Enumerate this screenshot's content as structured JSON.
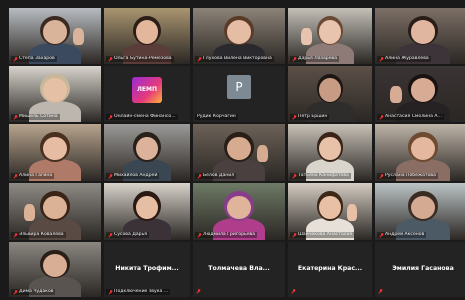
{
  "participants": [
    {
      "name": "Стёпа Захаров",
      "muted": true,
      "kind": "video",
      "bg": "#b8bcc0",
      "skin": "#d9b39a",
      "hair": "#3a2a20",
      "shirt": "#3b4a5e"
    },
    {
      "name": "Ольга Бутина-Ремезова",
      "muted": true,
      "kind": "video",
      "active": true,
      "bg": "#a99570",
      "skin": "#e2b79c",
      "hair": "#2c1d16",
      "shirt": "#5a3c38"
    },
    {
      "name": "Глухова Вилена Викторовна",
      "muted": true,
      "kind": "video",
      "bg": "#8c8378",
      "skin": "#e4bda4",
      "hair": "#5a3b28",
      "shirt": "#2a2a2e"
    },
    {
      "name": "Дарья Лазарева",
      "muted": true,
      "kind": "video",
      "bg": "#c4c0b8",
      "skin": "#e8c4ae",
      "hair": "#6a4a34",
      "shirt": "#8e7b78"
    },
    {
      "name": "Алина Журавлёва",
      "muted": true,
      "kind": "video",
      "bg": "#7c6f66",
      "skin": "#e0b6a0",
      "hair": "#2a1c16",
      "shirt": "#3c3438"
    },
    {
      "name": "Мишель Сотина",
      "muted": true,
      "kind": "video",
      "bg": "#d8d4cc",
      "skin": "#e6c0a4",
      "hair": "#c9b79a",
      "shirt": "#bcb6ae"
    },
    {
      "name": "Онлайн-смена Финансо...",
      "muted": true,
      "kind": "logo",
      "logo_text": "ЛЕМП"
    },
    {
      "name": "Рудик Корчагин",
      "muted": false,
      "kind": "avatar",
      "initial": "P"
    },
    {
      "name": "Пётр Ершин",
      "muted": true,
      "kind": "video",
      "bg": "#5c5048",
      "skin": "#c89c84",
      "hair": "#1e1612",
      "shirt": "#2f2c2c"
    },
    {
      "name": "Анастасия Смолина А...",
      "muted": true,
      "kind": "video",
      "bg": "#3a3434",
      "skin": "#d8ac94",
      "hair": "#1a1210",
      "shirt": "#262224"
    },
    {
      "name": "Алина Гагина",
      "muted": true,
      "kind": "video",
      "bg": "#b7a48e",
      "skin": "#e6bca2",
      "hair": "#4a3020",
      "shirt": "#b07a68"
    },
    {
      "name": "Михайлов Андрей",
      "muted": true,
      "kind": "video",
      "bg": "#9c9a98",
      "skin": "#dcb29a",
      "hair": "#2a201a",
      "shirt": "#3a4652"
    },
    {
      "name": "Белов Данил",
      "muted": true,
      "kind": "video",
      "bg": "#6c6258",
      "skin": "#d6ab90",
      "hair": "#2a1e18",
      "shirt": "#4a4040"
    },
    {
      "name": "Татьяна Канифатова",
      "muted": true,
      "kind": "video",
      "bg": "#c8c2b8",
      "skin": "#e8c2a8",
      "hair": "#3a2418",
      "shirt": "#d9d4cc"
    },
    {
      "name": "Руслана Побежатова",
      "muted": true,
      "kind": "video",
      "bg": "#beb4a8",
      "skin": "#e4b89e",
      "hair": "#6e4a30",
      "shirt": "#8a6e64"
    },
    {
      "name": "Эльвира Ковалёва",
      "muted": true,
      "kind": "video",
      "bg": "#8e8a84",
      "skin": "#dcb296",
      "hair": "#3a2418",
      "shirt": "#5a4a44"
    },
    {
      "name": "Сусова Дарья",
      "muted": true,
      "kind": "video",
      "bg": "#d8d2ca",
      "skin": "#e6bea4",
      "hair": "#2a1a12",
      "shirt": "#3a3236"
    },
    {
      "name": "Людмила Григорьева",
      "muted": true,
      "kind": "video",
      "bg": "#6e7a66",
      "skin": "#e0b49a",
      "hair": "#8a3c8c",
      "shirt": "#b03c8c"
    },
    {
      "name": "Шайчакова Анастасия",
      "muted": true,
      "kind": "video",
      "bg": "#d4ccc2",
      "skin": "#e8c0a6",
      "hair": "#3c2618",
      "shirt": "#e6e0d8"
    },
    {
      "name": "Андрей Аксёнов",
      "muted": true,
      "kind": "video",
      "bg": "#bcc4c6",
      "skin": "#d4aa92",
      "hair": "#3a2c22",
      "shirt": "#4c5a66"
    },
    {
      "name": "Дима Чудаков",
      "muted": true,
      "kind": "video",
      "bg": "#8a8680",
      "skin": "#d8ae94",
      "hair": "#2a1e18",
      "shirt": "#5a5450"
    },
    {
      "name": "Никита Трофим...",
      "muted": true,
      "kind": "name",
      "label": "Подключение звука ..."
    },
    {
      "name": "Толмачева Вла...",
      "muted": true,
      "kind": "name"
    },
    {
      "name": "Екатерина Крас...",
      "muted": true,
      "kind": "name"
    },
    {
      "name": "Эмилия Гасанова",
      "muted": true,
      "kind": "name"
    }
  ]
}
